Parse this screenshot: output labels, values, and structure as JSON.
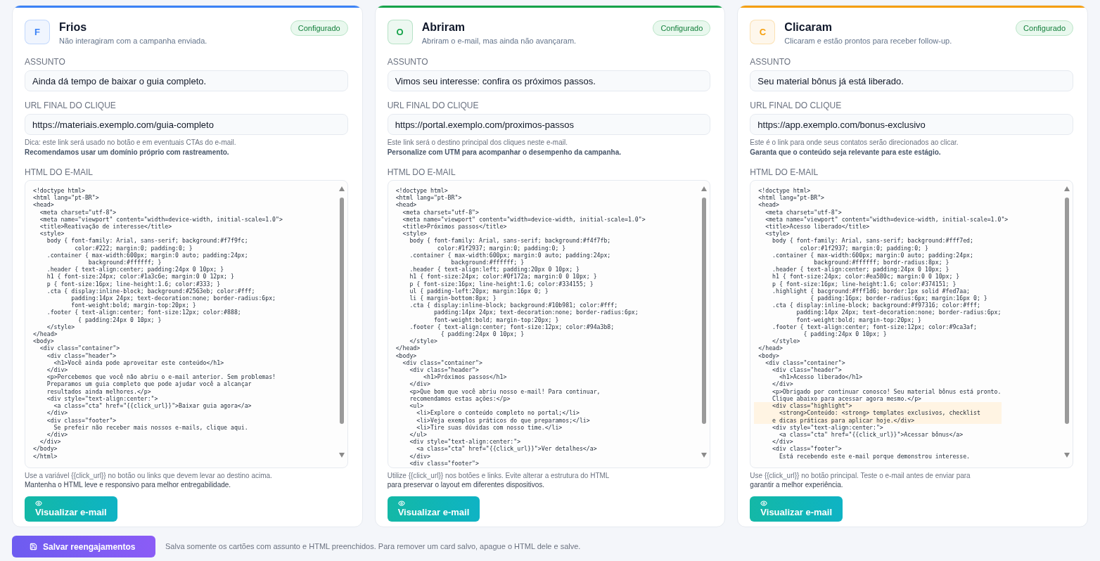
{
  "cards": [
    {
      "avatar": "F",
      "title": "Frios",
      "subtitle": "Não interagiram com a campanha enviada.",
      "color": "#3b82f6",
      "configured": true,
      "badge": "Configurado",
      "subject": {
        "label": "ASSUNTO",
        "value": "Ainda dá tempo de baixar o guia completo."
      },
      "url": {
        "label": "URL FINAL DO CLIQUE",
        "value": "https://materiais.exemplo.com/guia-completo"
      },
      "url_hint": {
        "text": "Dica: este link será usado no botão e em eventuais CTAs do e-mail.",
        "note": "Recomendamos usar um domínio próprio com rastreamento."
      },
      "html": {
        "label": "HTML DO E-MAIL",
        "code": [
          {
            "text": "<!doctype html>\n<html lang=\"pt-BR\">\n<head>\n  <meta charset=\"utf-8\">\n  <meta name=\"viewport\" content=\"width=device-width, initial-scale=1.0\">\n  <title>Reativação de interesse</title>\n  <style>\n    body { font-family: Arial, sans-serif; background:#f7f9fc;\n            color:#222; margin:0; padding:0; }\n    .container { max-width:600px; margin:0 auto; padding:24px;\n                background:#ffffff; }\n    .header { text-align:center; padding:24px 0 10px; }\n    h1 { font-size:24px; color:#1a3c6e; margin:0 0 12px; }\n    p { font-size:16px; line-height:1.6; color:#333; }\n    .cta { display:inline-block; background:#2563eb; color:#fff;\n           padding:14px 24px; text-decoration:none; border-radius:6px;\n           font-weight:bold; margin-top:20px; }\n    .footer { text-align:center; font-size:12px; color:#888;\n             { padding:24px 0 10px; }\n    </style>\n</head>\n<body>\n  <div class=\"container\">\n    <div class=\"header\">\n      <h1>Você ainda pode aproveitar este conteúdo</h1>\n    </div>\n    <p>Percebemos que você não abriu o e-mail anterior. Sem problemas!\n    Preparamos um guia completo que pode ajudar você a alcançar\n    resultados ainda melhores.</p>\n    <div style=\"text-align:center:\">\n      <a class=\"cta\" href=\"{{click_url}}\">Baixar guia agora</a>\n    </div>\n    <div class=\"footer\">\n      Se prefeir não receber mais nossos e-mails, clique aqui.\n    </div>\n  </div>\n</body>\n</html>",
            "highlighted": false
          }
        ]
      },
      "html_hint": {
        "text": "Use a variável {{click_url}} no botão ou links que devem levar ao destino acima.",
        "note": "Mantenha o HTML leve e responsivo para melhor entregabilidade."
      },
      "preview_button": "Visualizar e-mail"
    },
    {
      "avatar": "O",
      "title": "Abriram",
      "subtitle": "Abriram o e-mail, mas ainda não avançaram.",
      "color": "#16a34a",
      "configured": true,
      "badge": "Configurado",
      "subject": {
        "label": "ASSUNTO",
        "value": "Vimos seu interesse: confira os próximos passos."
      },
      "url": {
        "label": "URL FINAL DO CLIQUE",
        "value": "https://portal.exemplo.com/proximos-passos"
      },
      "url_hint": {
        "text": "Este link será o destino principal dos cliques neste e-mail.",
        "note": "Personalize com UTM para acompanhar o desempenho da campanha."
      },
      "html": {
        "label": "HTML DO E-MAIL",
        "code": [
          {
            "text": "<!doctype html>\n<html lang=\"pt-BR\">\n<head>\n  <meta charset=\"utf-8\">\n  <meta name=\"viewport\" content=\"width=device-width, initial-scale=1.0\">\n  <title>Próximos passos</title>\n  <style>\n    body { font-family: Arial, sans-serif; background:#f4f7fb;\n            color:#1f2937; margin:0; padding:0; }\n    .container { max-width:600px; margin:0 auto; padding:24px;\n                background:#ffffff; }\n    .header { text-align:left; padding:20px 0 10px; }\n    h1 { font-size:24px; color:#0f172a; margin:0 0 10px; }\n    p { font-size:16px; line-height:1.6; color:#334155; }\n    ul { padding-left:20px; margin:16px 0; }\n    li { margin-bottom:8px; }\n    .cta { display:inline-block; background:#10b981; color:#fff;\n           padding:14px 24px; text-decoration:none; border-radius:6px;\n           font-weight:bold; margin-top:20px; }\n    .footer { text-align:center; font-size:12px; color:#94a3b8;\n             { padding:24px 0 10px; }\n    </style>\n</head>\n<body>\n  <div class=\"container\">\n    <div class=\"header\">\n        <h1>Próximos passos</h1>\n    </div>\n    <p>Que bom que você abriu nosso e-mail! Para continuar,\n    recomendamos estas ações:</p>\n    <ul>\n      <li>Explore o conteúdo completo no portal;</li>\n      <li>Veja exemplos práticos do que preparamos;</li>\n      <li>Tire suas dúvidas com nosso time.</li>\n    </ul>\n    <div style=\"text-align:center:\">\n      <a class=\"cta\" href=\"{{click_url}}\">Ver detalhes</a>\n    </div>\n    <div class=\"footer\">",
            "highlighted": false
          }
        ]
      },
      "html_hint": {
        "text": "Utilize {{click_url}} nos botões e links. Evite alterar a estrutura do HTML",
        "note": "para preservar o layout em diferentes dispositivos."
      },
      "preview_button": "Visualizar e-mail"
    },
    {
      "avatar": "C",
      "title": "Clicaram",
      "subtitle": "Clicaram e estão prontos para receber follow-up.",
      "color": "#f59e0b",
      "configured": true,
      "badge": "Configurado",
      "subject": {
        "label": "ASSUNTO",
        "value": "Seu material bônus já está liberado."
      },
      "url": {
        "label": "URL FINAL DO CLIQUE",
        "value": "https://app.exemplo.com/bonus-exclusivo"
      },
      "url_hint": {
        "text": "Este é o link para onde seus contatos serão direcionados ao clicar.",
        "note": "Garanta que o conteúdo seja relevante para este estágio."
      },
      "html": {
        "label": "HTML DO E-MAIL",
        "code": [
          {
            "text": "<!doctype html>\n<html lang=\"pt-BR\">\n<head>\n  <meta charset=\"utf-8\">\n  <meta name=\"viewport\" content=\"width=device-width, initial-scale=1.0\">\n  <title>Acesso liberado</title>\n  <style>\n    body { font-family: Arial, sans-serif; background:#fff7ed;\n            color:#1f2937; margin:0; padding:0; }\n    .container { max-width:600px; margin:0 auto; padding:24px;\n                background:#ffffff; bordr-radius:8px; }\n    .header { text-align:center; padding:24px 0 10px; }\n    h1 { font-size:24px; color:#ea580c; margin:0 0 10px; }\n    p { font-size:16px; line-height:1.6; color:#374151; }\n    .highlight { bacground:#fff1d6; border:1px solid #fed7aa;\n               { padding:16px; border-radius:6px; margin:16px 0; }\n    .cta { display:inline-block; background:#f97316; color:#fff;\n           padding:14px 24px; text-decoration:none; border-radius:6px;\n           font-weight:bold; margin-top:20px; }\n    .footer { text-align:center; font-size:12px; color:#9ca3af;\n             { padding:24px 0 10px; }\n    </style>\n</head>\n<body>\n  <div class=\"container\">\n    <div class=\"header\">\n      <h1>Acesso liberado</h1>\n    </div>\n    <p>Obrigado por continuar conosco! Seu material bônus está pronto.\n    Clique abaixo para acessar agora mesmo.</p>",
            "highlighted": false
          },
          {
            "text": "    <div class=\"highlight\">\n      <strong>Conteúdo: <strong> templates exclusivos, checklist\n    e dicas práticas para aplicar hoje.</div>",
            "highlighted": true
          },
          {
            "text": "    <div style=\"text-align:center:\">\n      <a class=\"cta\" href=\"{{click_url}}\">Acessar bônus</a>\n    </div>\n    <div class=\"footer\">\n      Está recebendo este e-mail porque demonstrou interesse.",
            "highlighted": false
          }
        ]
      },
      "html_hint": {
        "text": "Use {{click_url}} no botão principal. Teste o e-mail antes de enviar para",
        "note": "garantir a melhor experiência."
      },
      "preview_button": "Visualizar e-mail"
    }
  ],
  "footer": {
    "save_button": "Salvar reengajamentos",
    "note": "Salva somente os cartões com assunto e HTML preenchidos. Para remover um card salvo, apague o HTML dele e salve."
  }
}
